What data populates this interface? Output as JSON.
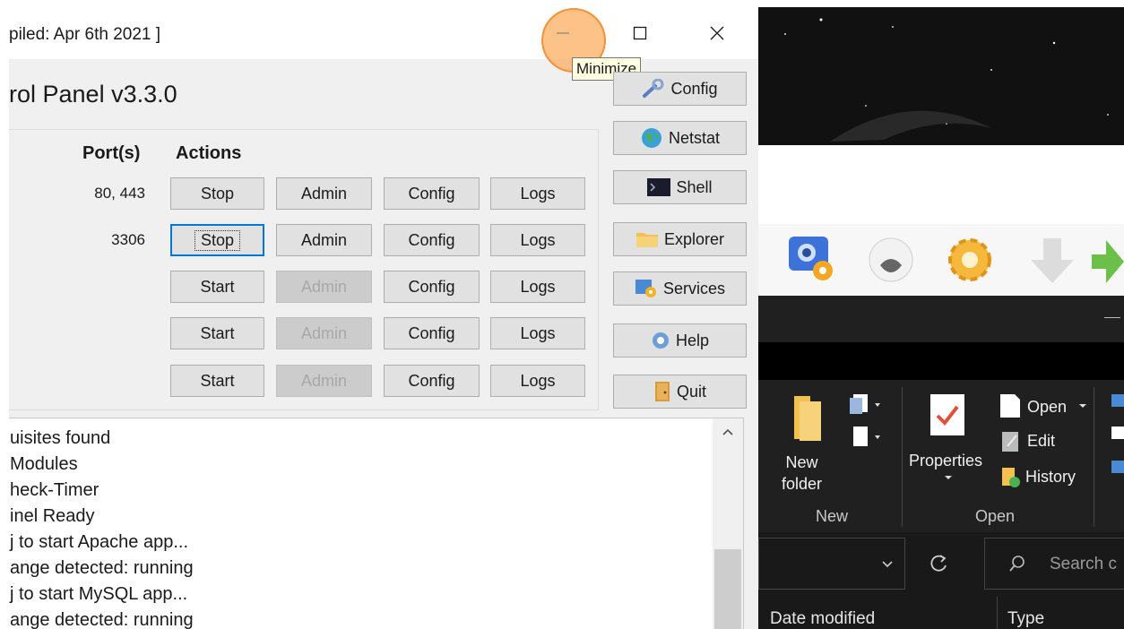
{
  "xampp": {
    "title": "piled: Apr 6th 2021 ]",
    "window_controls": {
      "minimize": "—",
      "maximize": "☐",
      "close": "✕"
    },
    "tooltip": "Minimize",
    "panel_title": "rol Panel v3.3.0",
    "headers": {
      "ports": "Port(s)",
      "actions": "Actions"
    },
    "modules": [
      {
        "ports": "80, 443",
        "start_stop": "Stop",
        "admin": "Admin",
        "admin_enabled": true,
        "config": "Config",
        "logs": "Logs"
      },
      {
        "ports": "3306",
        "start_stop": "Stop",
        "admin": "Admin",
        "admin_enabled": true,
        "config": "Config",
        "logs": "Logs"
      },
      {
        "ports": "",
        "start_stop": "Start",
        "admin": "Admin",
        "admin_enabled": false,
        "config": "Config",
        "logs": "Logs"
      },
      {
        "ports": "",
        "start_stop": "Start",
        "admin": "Admin",
        "admin_enabled": false,
        "config": "Config",
        "logs": "Logs"
      },
      {
        "ports": "",
        "start_stop": "Start",
        "admin": "Admin",
        "admin_enabled": false,
        "config": "Config",
        "logs": "Logs"
      }
    ],
    "side_buttons": {
      "config": "Config",
      "netstat": "Netstat",
      "shell": "Shell",
      "explorer": "Explorer",
      "services": "Services",
      "help": "Help",
      "quit": "Quit"
    },
    "log_lines": [
      "uisites found",
      " Modules",
      "heck-Timer",
      "inel Ready",
      "j to start Apache app...",
      "ange detected: running",
      "j to start MySQL app...",
      "ange detected: running"
    ]
  },
  "explorer": {
    "ribbon": {
      "new_folder": "New\nfolder",
      "new_group": "New",
      "properties": "Properties",
      "open": "Open",
      "edit": "Edit",
      "history": "History",
      "open_group": "Open"
    },
    "search_placeholder": "Search c",
    "columns": {
      "date_modified": "Date modified",
      "type": "Type"
    }
  },
  "colors": {
    "focus_border": "#0078d7",
    "highlight": "#fcaa5a",
    "tooltip_bg": "#ffffe1",
    "explorer_dark": "#202020"
  }
}
